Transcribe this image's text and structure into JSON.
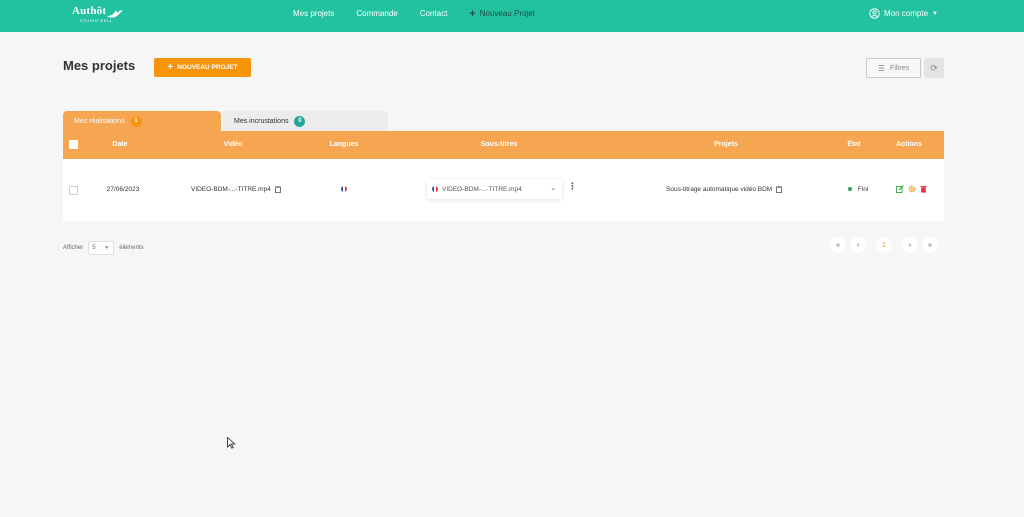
{
  "navbar": {
    "brand": "Authôt",
    "brand_sub": "STUDIO BELL",
    "links": [
      "Mes projets",
      "Commande",
      "Contact"
    ],
    "new_project_label": "Nouveau Projet",
    "account_label": "Mon compte",
    "background": "#22c2a1"
  },
  "header": {
    "title": "Mes projets",
    "new_project_button": "NOUVEAU PROJET",
    "filters_button": "Filtres"
  },
  "tabs": [
    {
      "label": "Mes réalisations",
      "count": "1",
      "active": true
    },
    {
      "label": "Mes incrustations",
      "count": "0",
      "active": false
    }
  ],
  "table": {
    "columns": [
      "Date",
      "Vidéo",
      "Langues",
      "Sous-titres",
      "Projets",
      "État",
      "Actions"
    ],
    "rows": [
      {
        "date": "27/06/2023",
        "video": "VIDEO-BDM-...-TITRE.mp4",
        "language_flag": "french-flag-icon",
        "subtitle_file": "VIDEO-BDM-...-TITRE.mp4",
        "project": "Sous-titrage automatique vidéo BDM",
        "status": "Fini"
      }
    ]
  },
  "pagination": {
    "show_label": "Afficher",
    "page_size": "5",
    "elements_label": "éléments",
    "first": "«",
    "prev": "‹",
    "current_page": "1",
    "next": "›",
    "last": "»"
  },
  "colors": {
    "accent_orange": "#f7940a",
    "table_header": "#f6a550",
    "teal": "#22a89a",
    "status_green": "#22a85a"
  }
}
